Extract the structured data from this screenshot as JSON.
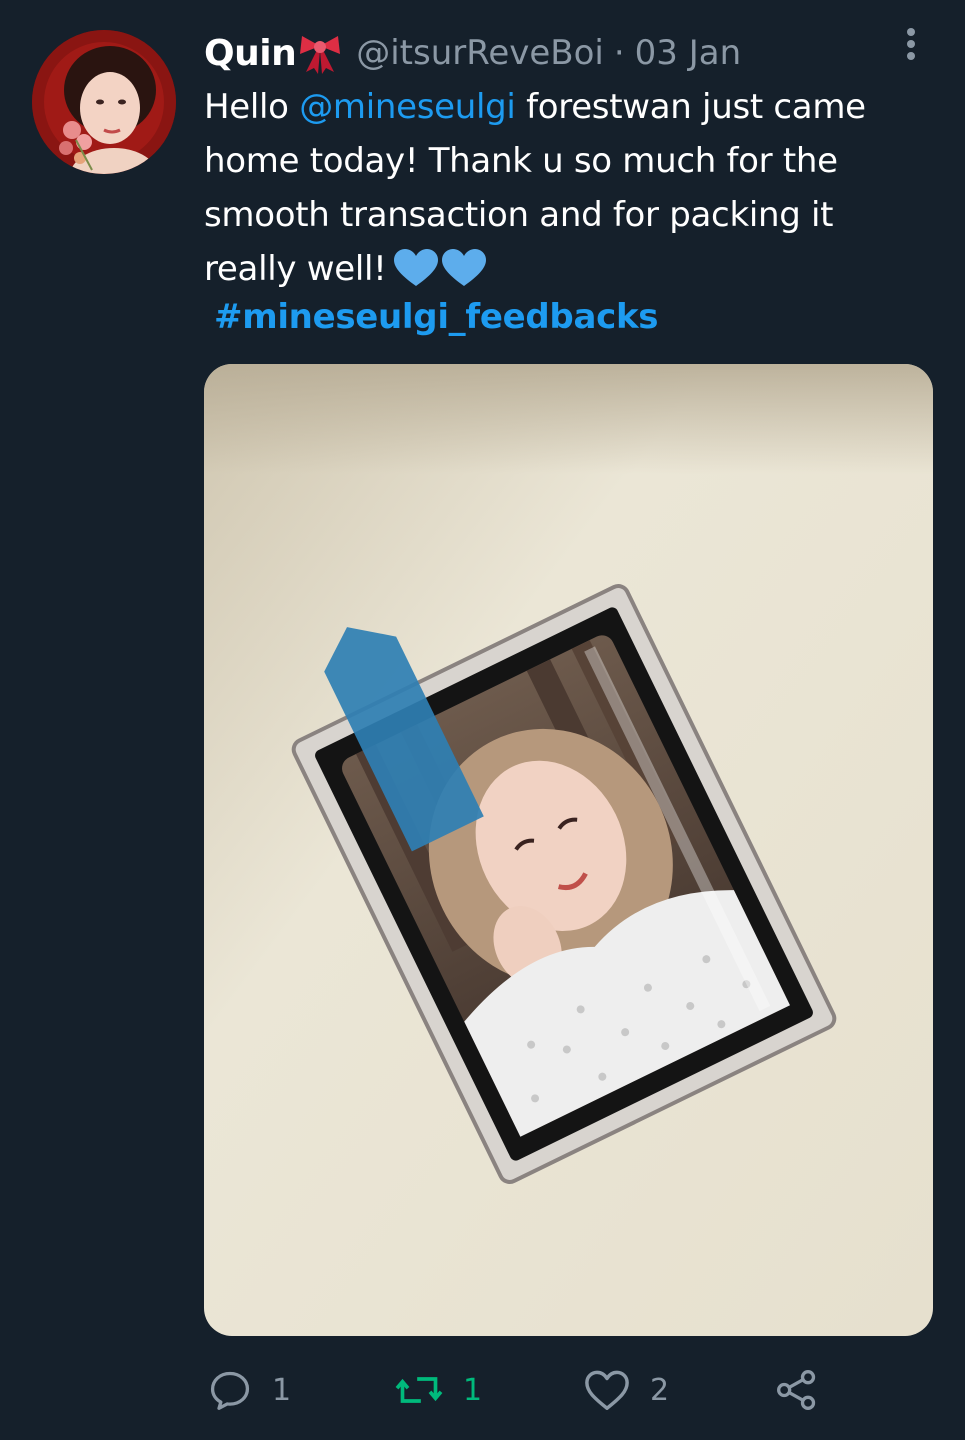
{
  "tweet": {
    "author": {
      "display_name": "Quin",
      "handle": "@itsurReveBoi",
      "avatar_icon": "profile-photo"
    },
    "date_separator": "·",
    "date": "03 Jan",
    "text": {
      "part1": "Hello ",
      "mention": "@mineseulgi",
      "part2": " forestwan just came home today! Thank u so much for the smooth transaction and for packing it really well!"
    },
    "hashtag": "#mineseulgi_feedbacks",
    "media_description_icon": "photo-toploader-card",
    "actions": {
      "reply_count": "1",
      "retweet_count": "1",
      "like_count": "2"
    }
  },
  "colors": {
    "background": "#15202b",
    "link": "#1d9bf0",
    "muted": "#8b98a5",
    "retweet": "#00ba7c",
    "heart_emoji": "#5dadec",
    "ribbon_emoji": "#dd2e44"
  }
}
